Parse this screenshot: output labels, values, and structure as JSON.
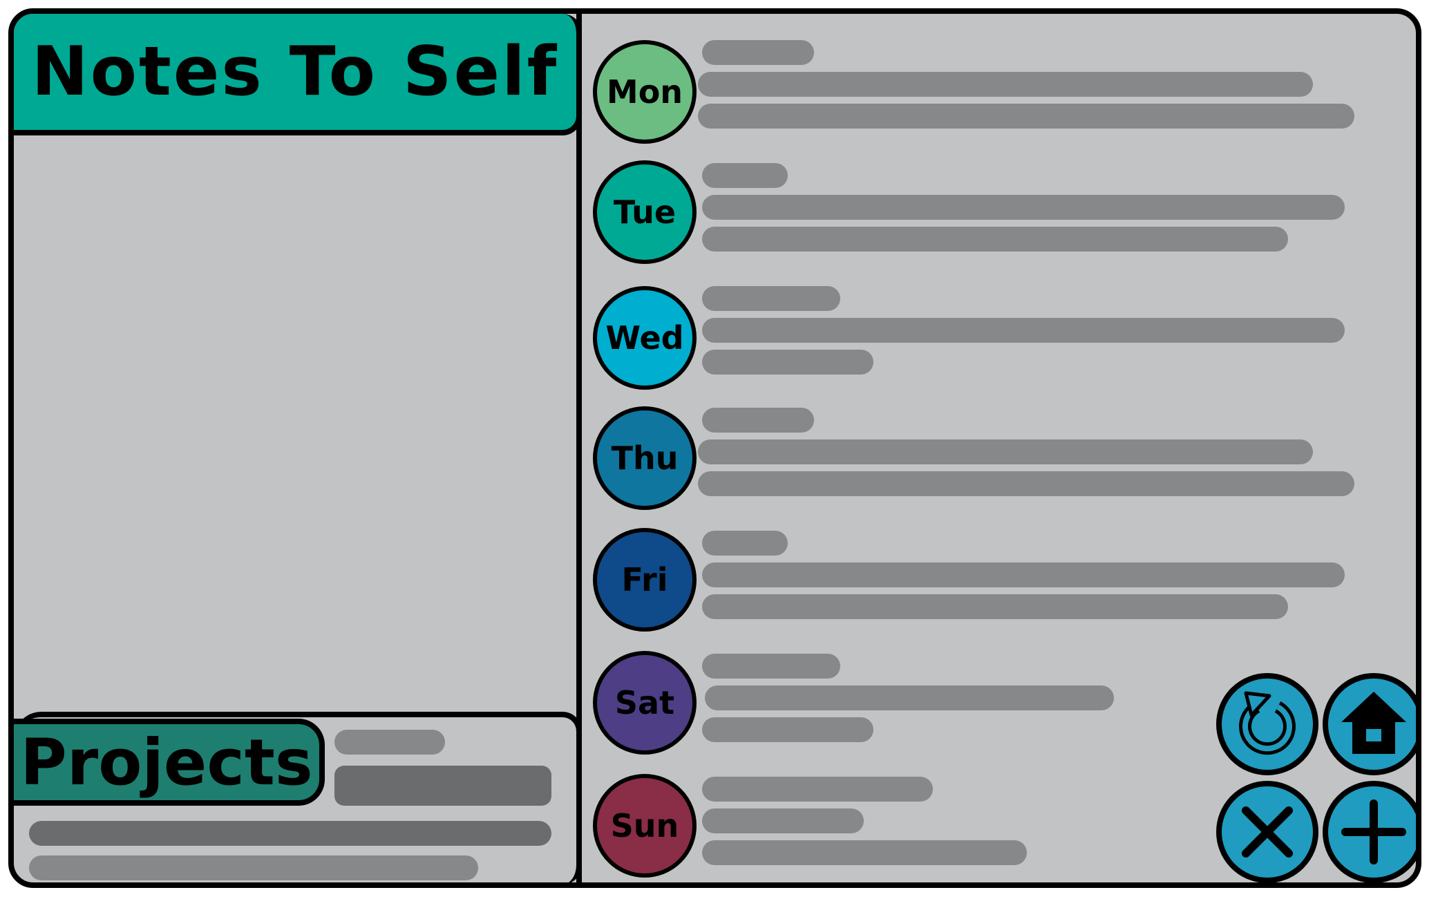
{
  "app": {
    "title": "Notes To Self",
    "projects_label": "Projects"
  },
  "colors": {
    "title_bg": "#00a993",
    "projects_bg": "#1e7f70",
    "panel_bg": "#c2c3c5",
    "placeholder_dark": "#6b6c6e",
    "placeholder_mid": "#878889",
    "action_bg": "#1f9cc0"
  },
  "days": [
    {
      "label": "Mon",
      "color": "#6bbd82"
    },
    {
      "label": "Tue",
      "color": "#00a993"
    },
    {
      "label": "Wed",
      "color": "#00aed0"
    },
    {
      "label": "Thu",
      "color": "#0f76a0"
    },
    {
      "label": "Fri",
      "color": "#0f4a8a"
    },
    {
      "label": "Sat",
      "color": "#4d3e86"
    },
    {
      "label": "Sun",
      "color": "#8a2d46"
    }
  ],
  "actions": [
    {
      "name": "refresh-button",
      "icon": "refresh-icon"
    },
    {
      "name": "home-button",
      "icon": "home-icon"
    },
    {
      "name": "close-button",
      "icon": "close-icon"
    },
    {
      "name": "add-button",
      "icon": "plus-icon"
    }
  ]
}
